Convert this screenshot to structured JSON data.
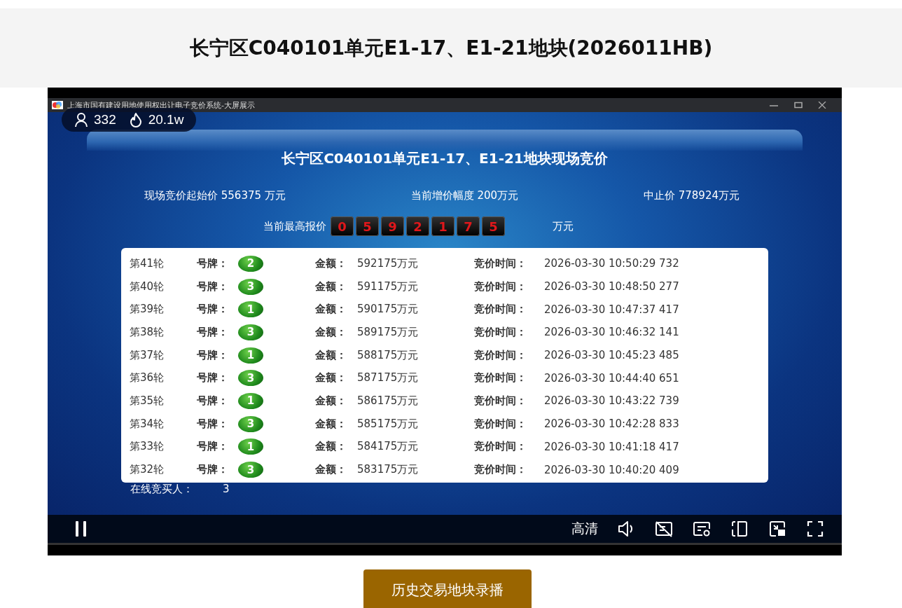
{
  "page_title": "长宁区C040101单元E1-17、E1-21地块(2026011HB)",
  "player": {
    "viewers": "332",
    "heat": "20.1w",
    "playing": true,
    "quality": "高清",
    "app": {
      "window_title": "上海市国有建设用地使用权出让电子竞价系统-大屏展示",
      "heading": "长宁区C040101单元E1-17、E1-21地块现场竞价",
      "stats": [
        "现场竞价起始价 556375 万元",
        "当前增价幅度 200万元",
        "中止价 778924万元"
      ],
      "highest_label": "当前最高报价",
      "highest_digits": [
        "0",
        "5",
        "9",
        "2",
        "1",
        "7",
        "5"
      ],
      "highest_unit": "万元",
      "bids": [
        {
          "round": "第41轮",
          "plate_label": "号牌：",
          "plate": "2",
          "amount_label": "金额：",
          "amount": "592175万元",
          "time_label": "竞价时间：",
          "time": "2026-03-30 10:50:29 732"
        },
        {
          "round": "第40轮",
          "plate_label": "号牌：",
          "plate": "3",
          "amount_label": "金额：",
          "amount": "591175万元",
          "time_label": "竞价时间：",
          "time": "2026-03-30 10:48:50 277"
        },
        {
          "round": "第39轮",
          "plate_label": "号牌：",
          "plate": "1",
          "amount_label": "金额：",
          "amount": "590175万元",
          "time_label": "竞价时间：",
          "time": "2026-03-30 10:47:37 417"
        },
        {
          "round": "第38轮",
          "plate_label": "号牌：",
          "plate": "3",
          "amount_label": "金额：",
          "amount": "589175万元",
          "time_label": "竞价时间：",
          "time": "2026-03-30 10:46:32 141"
        },
        {
          "round": "第37轮",
          "plate_label": "号牌：",
          "plate": "1",
          "amount_label": "金额：",
          "amount": "588175万元",
          "time_label": "竞价时间：",
          "time": "2026-03-30 10:45:23 485"
        },
        {
          "round": "第36轮",
          "plate_label": "号牌：",
          "plate": "3",
          "amount_label": "金额：",
          "amount": "587175万元",
          "time_label": "竞价时间：",
          "time": "2026-03-30 10:44:40 651"
        },
        {
          "round": "第35轮",
          "plate_label": "号牌：",
          "plate": "1",
          "amount_label": "金额：",
          "amount": "586175万元",
          "time_label": "竞价时间：",
          "time": "2026-03-30 10:43:22 739"
        },
        {
          "round": "第34轮",
          "plate_label": "号牌：",
          "plate": "3",
          "amount_label": "金额：",
          "amount": "585175万元",
          "time_label": "竞价时间：",
          "time": "2026-03-30 10:42:28 833"
        },
        {
          "round": "第33轮",
          "plate_label": "号牌：",
          "plate": "1",
          "amount_label": "金额：",
          "amount": "584175万元",
          "time_label": "竞价时间：",
          "time": "2026-03-30 10:41:18 417"
        },
        {
          "round": "第32轮",
          "plate_label": "号牌：",
          "plate": "3",
          "amount_label": "金额：",
          "amount": "583175万元",
          "time_label": "竞价时间：",
          "time": "2026-03-30 10:40:20 409"
        }
      ],
      "online_label": "在线竞买人：",
      "online_count": "3"
    }
  },
  "history_button": "历史交易地块录播"
}
